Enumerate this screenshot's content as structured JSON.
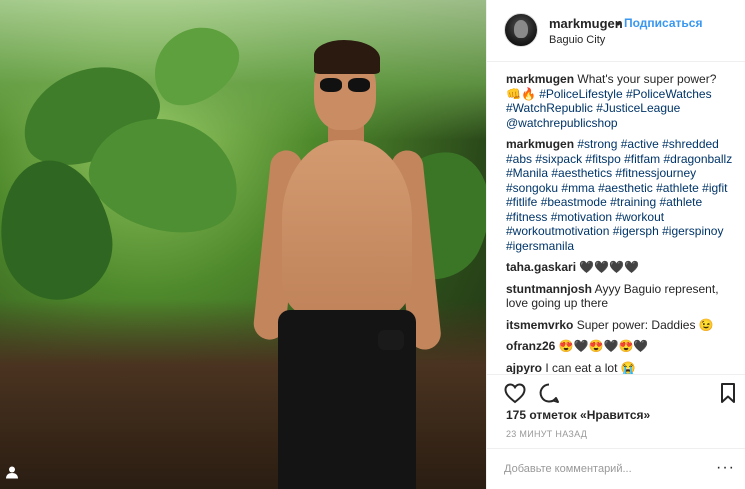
{
  "post": {
    "username": "markmugen",
    "separator": "•",
    "follow_label": "Подписаться",
    "location": "Baguio City",
    "profile_icon": "person-icon"
  },
  "comments": [
    {
      "user": "markmugen",
      "parts": [
        {
          "t": " What's your super power? "
        },
        {
          "e": "👊"
        },
        {
          "e": "🔥"
        },
        {
          "t": " "
        },
        {
          "h": "#PoliceLifestyle"
        },
        {
          "t": " "
        },
        {
          "h": "#PoliceWatches"
        },
        {
          "t": " "
        },
        {
          "h": "#WatchRepublic"
        },
        {
          "t": " "
        },
        {
          "h": "#JusticeLeague"
        },
        {
          "t": " "
        },
        {
          "h": "@watchrepublicshop"
        }
      ]
    },
    {
      "user": "markmugen",
      "parts": [
        {
          "t": " "
        },
        {
          "h": "#strong"
        },
        {
          "t": " "
        },
        {
          "h": "#active"
        },
        {
          "t": " "
        },
        {
          "h": "#shredded"
        },
        {
          "t": " "
        },
        {
          "h": "#abs"
        },
        {
          "t": " "
        },
        {
          "h": "#sixpack"
        },
        {
          "t": " "
        },
        {
          "h": "#fitspo"
        },
        {
          "t": " "
        },
        {
          "h": "#fitfam"
        },
        {
          "t": " "
        },
        {
          "h": "#dragonballz"
        },
        {
          "t": " "
        },
        {
          "h": "#Manila"
        },
        {
          "t": " "
        },
        {
          "h": "#aesthetics"
        },
        {
          "t": " "
        },
        {
          "h": "#fitnessjourney"
        },
        {
          "t": " "
        },
        {
          "h": "#songoku"
        },
        {
          "t": " "
        },
        {
          "h": "#mma"
        },
        {
          "t": " "
        },
        {
          "h": "#aesthetic"
        },
        {
          "t": " "
        },
        {
          "h": "#athlete"
        },
        {
          "t": " "
        },
        {
          "h": "#igfit"
        },
        {
          "t": " "
        },
        {
          "h": "#fitlife"
        },
        {
          "t": " "
        },
        {
          "h": "#beastmode"
        },
        {
          "t": " "
        },
        {
          "h": "#training"
        },
        {
          "t": " "
        },
        {
          "h": "#athlete"
        },
        {
          "t": " "
        },
        {
          "h": "#fitness"
        },
        {
          "t": " "
        },
        {
          "h": "#motivation"
        },
        {
          "t": " "
        },
        {
          "h": "#workout"
        },
        {
          "t": " "
        },
        {
          "h": "#workoutmotivation"
        },
        {
          "t": " "
        },
        {
          "h": "#igersph"
        },
        {
          "t": " "
        },
        {
          "h": "#igerspinoy"
        },
        {
          "t": " "
        },
        {
          "h": "#igersmanila"
        }
      ]
    },
    {
      "user": "taha.gaskari",
      "parts": [
        {
          "t": " "
        },
        {
          "e": "🖤🖤🖤🖤"
        }
      ]
    },
    {
      "user": "stuntmannjosh",
      "parts": [
        {
          "t": " Ayyy Baguio represent, love going up there"
        }
      ]
    },
    {
      "user": "itsmemvrko",
      "parts": [
        {
          "t": " Super power: Daddies "
        },
        {
          "e": "😉"
        }
      ]
    },
    {
      "user": "ofranz26",
      "parts": [
        {
          "t": " "
        },
        {
          "e": "😍🖤😍🖤😍🖤"
        }
      ]
    },
    {
      "user": "ajpyro",
      "parts": [
        {
          "t": " I can eat a lot "
        },
        {
          "e": "😭"
        }
      ]
    }
  ],
  "actions": {
    "like_icon": "heart-icon",
    "comment_icon": "comment-bubble-icon",
    "save_icon": "bookmark-icon",
    "likes_text": "175 отметок «Нравится»",
    "time_text": "23 МИНУТ НАЗАД"
  },
  "add_comment": {
    "placeholder": "Добавьте комментарий...",
    "more_label": "···"
  },
  "colors": {
    "link": "#3897f0",
    "hashtag": "#003569",
    "text": "#262626",
    "muted": "#999999"
  }
}
